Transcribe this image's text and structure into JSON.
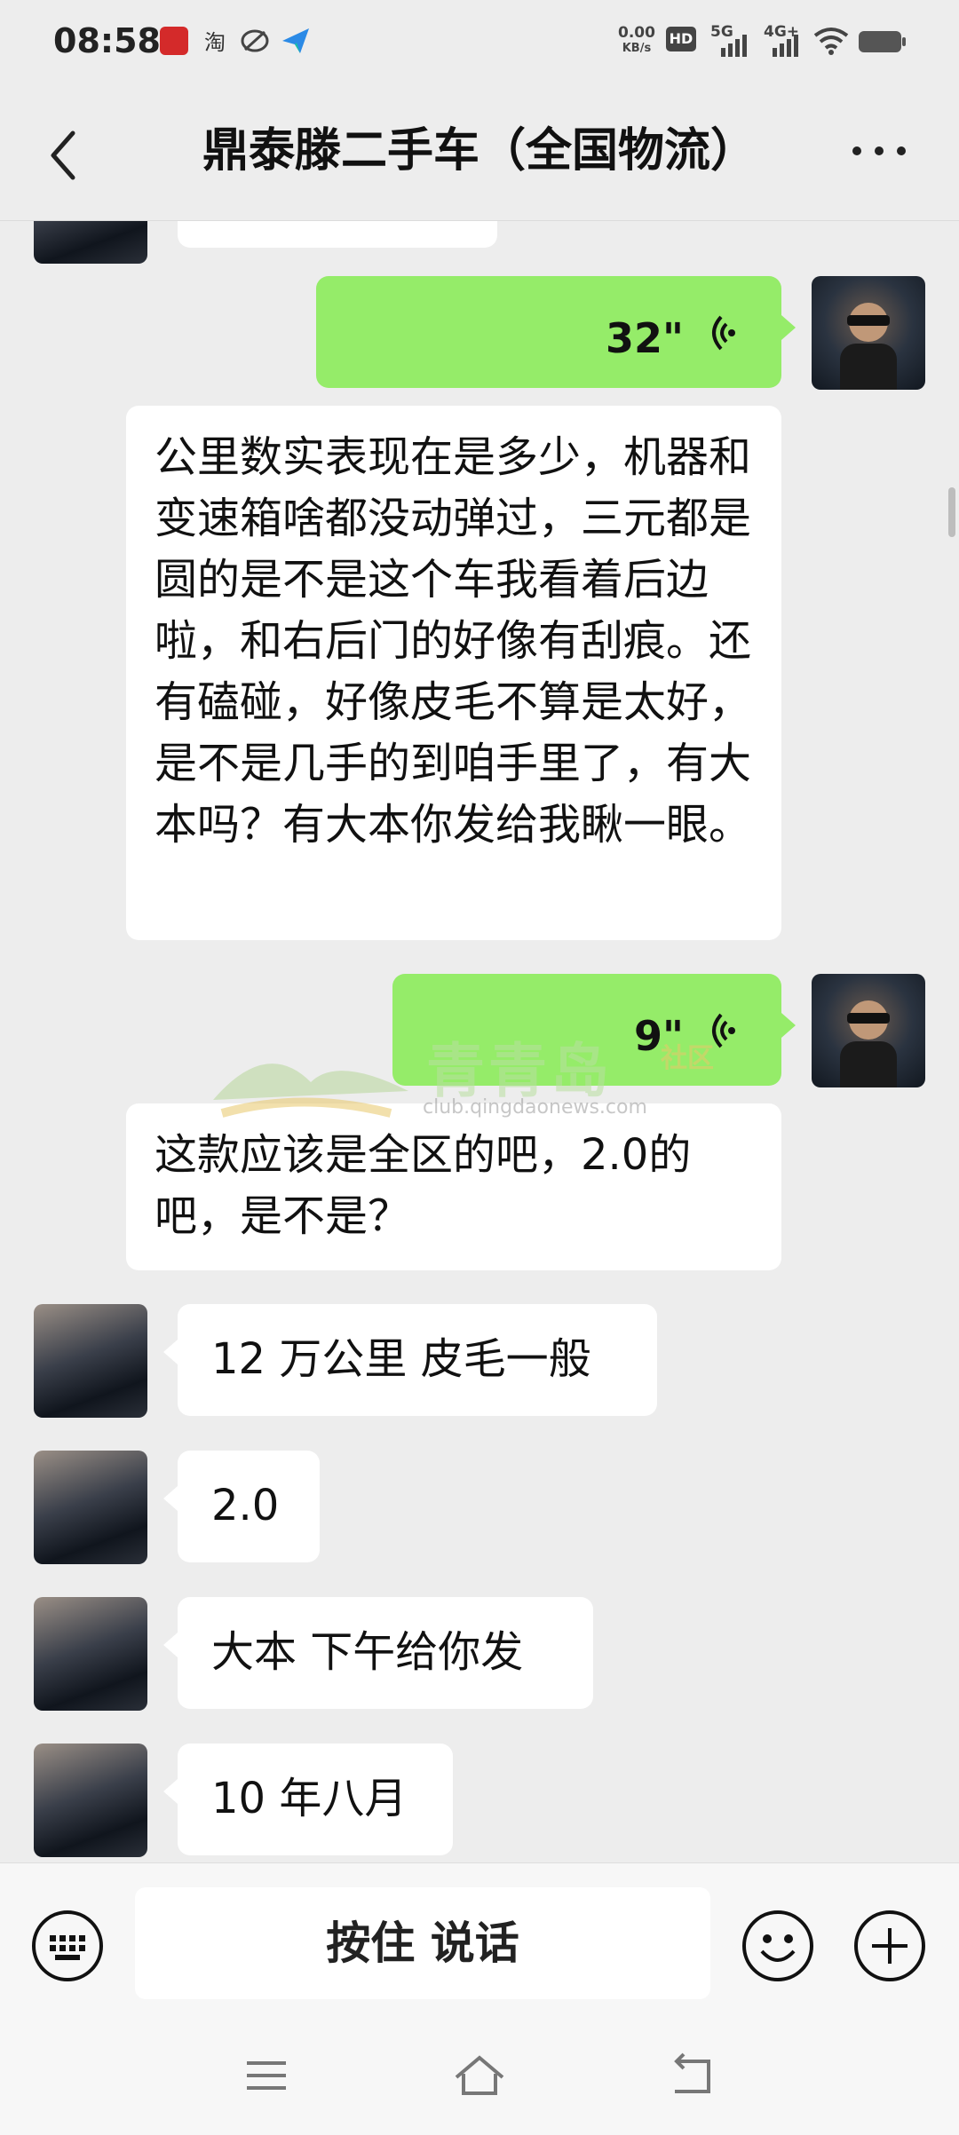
{
  "status_bar": {
    "time": "08:58",
    "net_speed_top": "0.00",
    "net_speed_bottom": "KB/s",
    "net1": "5G",
    "net2": "4G+",
    "app_icon_taobao": "淘"
  },
  "header": {
    "title": "鼎泰滕二手车（全国物流）"
  },
  "messages": [
    {
      "side": "right",
      "type": "voice",
      "duration": "32\""
    },
    {
      "side": "right",
      "type": "text",
      "text": "公里数实表现在是多少，机器和变速箱啥都没动弹过，三元都是圆的是不是这个车我看着后边啦，和右后门的好像有刮痕。还有磕碰，好像皮毛不算是太好，是不是几手的到咱手里了，有大本吗？有大本你发给我瞅一眼。"
    },
    {
      "side": "right",
      "type": "voice",
      "duration": "9\""
    },
    {
      "side": "right",
      "type": "text",
      "text": "这款应该是全区的吧，2.0的吧，是不是？"
    },
    {
      "side": "left",
      "type": "text",
      "text": "12 万公里 皮毛一般"
    },
    {
      "side": "left",
      "type": "text",
      "text": "2.0"
    },
    {
      "side": "left",
      "type": "text",
      "text": "大本 下午给你发"
    },
    {
      "side": "left",
      "type": "text",
      "text": "10 年八月"
    }
  ],
  "watermark": {
    "brand": "青青岛",
    "sub": "社区",
    "url": "club.qingdaonews.com"
  },
  "input_bar": {
    "hold_to_talk": "按住 说话"
  },
  "colors": {
    "sent_bubble": "#95ec69",
    "received_bubble": "#ffffff",
    "background": "#ededed"
  }
}
